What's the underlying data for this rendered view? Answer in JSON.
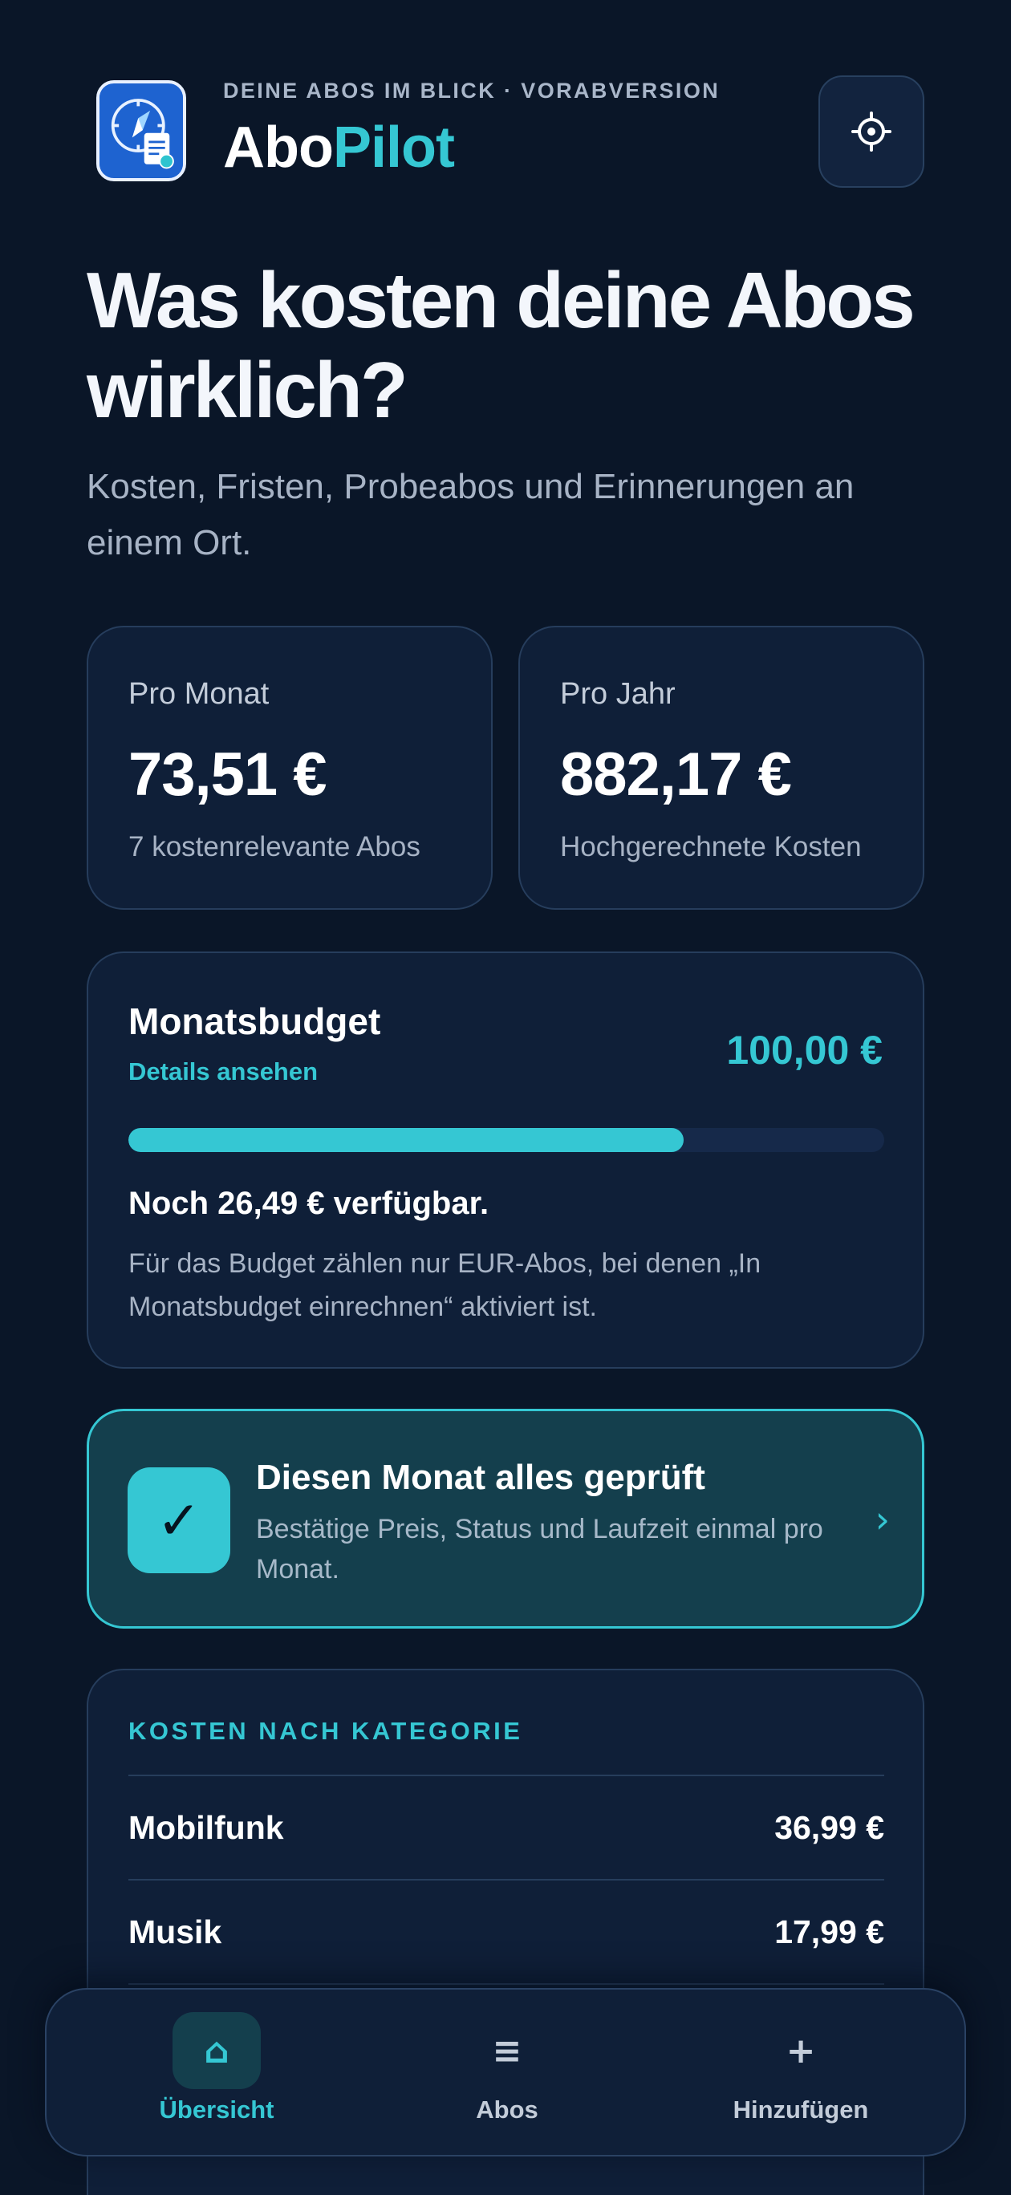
{
  "header": {
    "eyebrow": "DEINE ABOS IM BLICK · VORABVERSION",
    "brand_part1": "Abo",
    "brand_part2": "Pilot",
    "logo_icon": "compass-document-icon",
    "settings_icon": "gear-icon"
  },
  "hero": {
    "title": "Was kosten deine Abos wirklich?",
    "subtitle": "Kosten, Fristen, Probeabos und Erinnerungen an einem Ort."
  },
  "stats": [
    {
      "label": "Pro Monat",
      "value": "73,51 €",
      "note": "7 kostenrelevante Abos"
    },
    {
      "label": "Pro Jahr",
      "value": "882,17 €",
      "note": "Hochgerechnete Kosten"
    }
  ],
  "budget": {
    "title": "Monatsbudget",
    "link": "Details ansehen",
    "amount": "100,00 €",
    "progress_fraction": 0.735,
    "remaining": "Noch 26,49 € verfügbar.",
    "hint": "Für das Budget zählen nur EUR-Abos, bei denen „In Monatsbudget einrechnen“ aktiviert ist."
  },
  "monthly_check": {
    "icon": "checkmark-icon",
    "check_glyph": "✓",
    "title": "Diesen Monat alles geprüft",
    "description": "Bestätige Preis, Status und Laufzeit einmal pro Monat.",
    "chevron": "›"
  },
  "categories": {
    "heading": "KOSTEN NACH KATEGORIE",
    "items": [
      {
        "name": "Mobilfunk",
        "amount": "36,99 €"
      },
      {
        "name": "Musik",
        "amount": "17,99 €"
      }
    ]
  },
  "nav": {
    "items": [
      {
        "label": "Übersicht",
        "icon": "home-icon",
        "glyph": "⌂",
        "active": true
      },
      {
        "label": "Abos",
        "icon": "list-icon",
        "glyph": "≡",
        "active": false
      },
      {
        "label": "Hinzufügen",
        "icon": "plus-icon",
        "glyph": "+",
        "active": false
      }
    ]
  },
  "colors": {
    "background": "#0a1628",
    "card": "#0f1f38",
    "accent": "#35c7d3",
    "muted_text": "#a7b3c5"
  }
}
